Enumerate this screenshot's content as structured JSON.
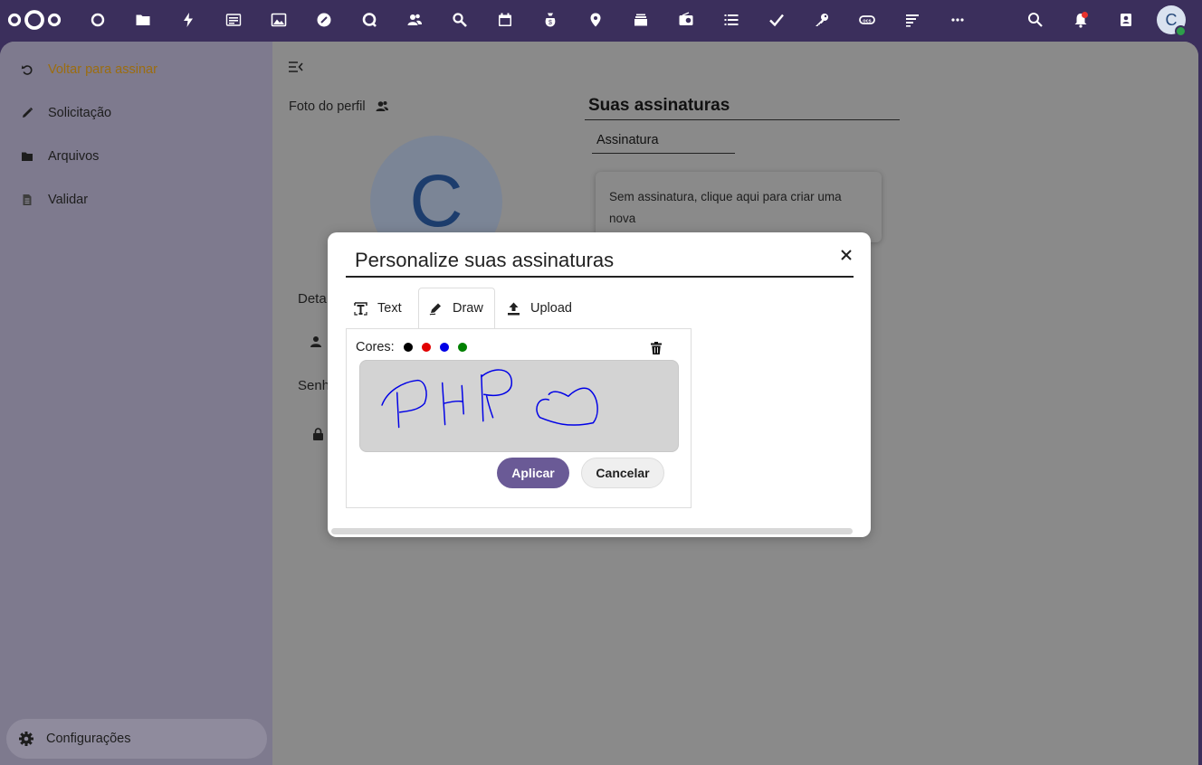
{
  "topbar": {
    "apps": [
      "dashboard-icon",
      "files-icon",
      "activity-icon",
      "bookmarks-icon",
      "photos-icon",
      "mail-icon",
      "talk-icon",
      "contacts-icon",
      "search-apps-icon",
      "calendar-icon",
      "cospend-icon",
      "maps-icon",
      "deck-icon",
      "news-icon",
      "tasks-icon",
      "checklist-icon",
      "passwords-icon",
      "office-icon",
      "notes-icon",
      "more-apps-icon"
    ],
    "right": [
      "search-icon",
      "notifications-icon",
      "contacts-menu-icon"
    ],
    "avatar_initial": "C"
  },
  "sidebar": {
    "items": [
      {
        "label": "Voltar para assinar",
        "icon": "undo-icon"
      },
      {
        "label": "Solicitação",
        "icon": "pencil-icon"
      },
      {
        "label": "Arquivos",
        "icon": "folder-icon"
      },
      {
        "label": "Validar",
        "icon": "document-icon"
      }
    ],
    "settings_label": "Configurações"
  },
  "content": {
    "profile_photo_label": "Foto do perfil",
    "avatar_initial": "C",
    "details_label": "Deta",
    "password_label": "Senh",
    "signatures_heading": "Suas assinaturas",
    "signature_tab": "Assinatura",
    "empty_signature_text": "Sem assinatura, clique aqui para criar uma nova"
  },
  "modal": {
    "title": "Personalize suas assinaturas",
    "tabs": [
      {
        "label": "Text",
        "icon": "text-icon"
      },
      {
        "label": "Draw",
        "icon": "draw-icon",
        "active": true
      },
      {
        "label": "Upload",
        "icon": "upload-icon"
      }
    ],
    "colors_label": "Cores:",
    "colors": [
      "#000000",
      "#e10000",
      "#0000e6",
      "#008000"
    ],
    "drawing_stroke_color": "#0000e6",
    "apply_label": "Aplicar",
    "cancel_label": "Cancelar"
  },
  "colors": {
    "topbar": "#3b2f5c",
    "primary": "#6a5a96",
    "active_nav": "#9c6d0f"
  }
}
